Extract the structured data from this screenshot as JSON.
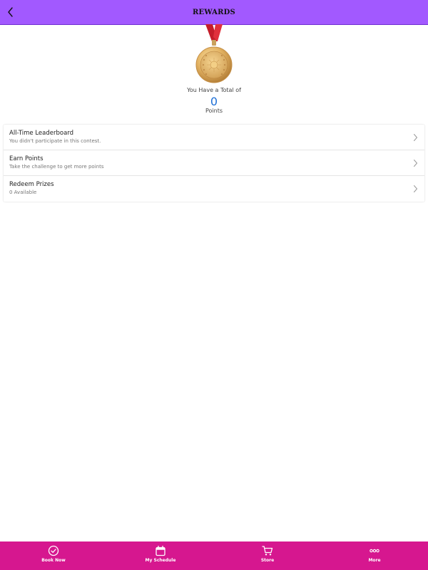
{
  "colors": {
    "header_bg": "#a259ff",
    "tabbar_bg": "#d6178f",
    "points_accent": "#1d6fd6"
  },
  "header": {
    "title": "REWARDS",
    "back_icon": "chevron-left-icon"
  },
  "summary": {
    "caption": "You Have a Total of",
    "points": "0",
    "points_label": "Points",
    "icon": "gold-medal-icon"
  },
  "menu": {
    "items": [
      {
        "title": "All-Time Leaderboard",
        "subtitle": "You didn't participate in this contest.",
        "icon": "chevron-right-icon"
      },
      {
        "title": "Earn Points",
        "subtitle": "Take the challenge to get more points",
        "icon": "chevron-right-icon"
      },
      {
        "title": "Redeem Prizes",
        "subtitle": "0 Available",
        "icon": "chevron-right-icon"
      }
    ]
  },
  "tabbar": {
    "tabs": [
      {
        "label": "Book Now",
        "icon": "check-circle-icon"
      },
      {
        "label": "My Schedule",
        "icon": "calendar-icon"
      },
      {
        "label": "Store",
        "icon": "cart-icon"
      },
      {
        "label": "More",
        "icon": "more-dots-icon"
      }
    ]
  }
}
